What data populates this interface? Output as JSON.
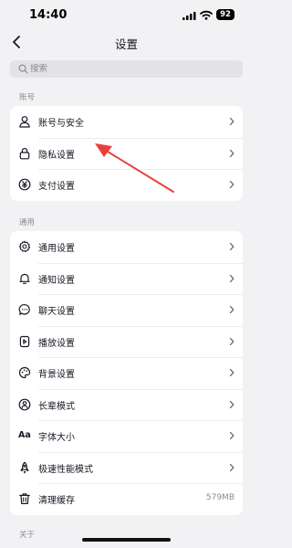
{
  "status_bar": {
    "time": "14:40",
    "battery": "92"
  },
  "nav": {
    "title": "设置"
  },
  "search": {
    "placeholder": "搜索"
  },
  "sections": {
    "account": {
      "label": "账号",
      "items": [
        {
          "label": "账号与安全",
          "icon": "user-icon"
        },
        {
          "label": "隐私设置",
          "icon": "lock-icon"
        },
        {
          "label": "支付设置",
          "icon": "yuan-icon"
        }
      ]
    },
    "general": {
      "label": "通用",
      "items": [
        {
          "label": "通用设置",
          "icon": "gear-icon"
        },
        {
          "label": "通知设置",
          "icon": "bell-icon"
        },
        {
          "label": "聊天设置",
          "icon": "chat-icon"
        },
        {
          "label": "播放设置",
          "icon": "play-icon"
        },
        {
          "label": "背景设置",
          "icon": "palette-icon"
        },
        {
          "label": "长辈模式",
          "icon": "elder-mode-icon"
        },
        {
          "label": "字体大小",
          "icon": "font-size-icon",
          "icon_text": "Aa"
        },
        {
          "label": "极速性能模式",
          "icon": "rocket-icon"
        },
        {
          "label": "清理缓存",
          "icon": "trash-icon",
          "value": "579MB"
        }
      ]
    },
    "about": {
      "label": "关于"
    }
  },
  "colors": {
    "annotation_arrow": "#e8413b",
    "background": "#f2f2f4",
    "card": "#ffffff"
  }
}
